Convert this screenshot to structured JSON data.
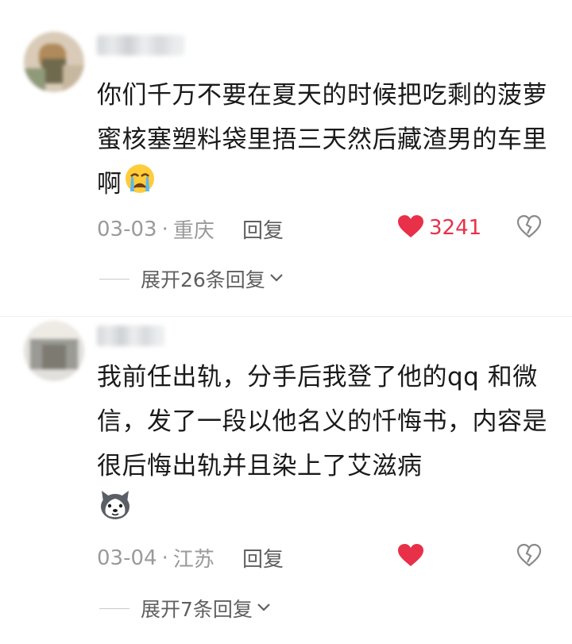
{
  "comments": [
    {
      "text": "你们千万不要在夏天的时候把吃剩的菠萝蜜核塞塑料袋里捂三天然后藏渣男的车里啊",
      "emoji_icon": "crying-face-icon",
      "date": "03-03",
      "location": "重庆",
      "reply_label": "回复",
      "likes": "3241",
      "expand_label": "展开26条回复"
    },
    {
      "text": "我前任出轨，分手后我登了他的qq 和微信，发了一段以他名义的忏悔书，内容是很后悔出轨并且染上了艾滋病",
      "emoji_icon": "husky-dog-icon",
      "date": "03-04",
      "location": "江苏",
      "reply_label": "回复",
      "likes": "",
      "expand_label": "展开7条回复"
    }
  ],
  "colors": {
    "like": "#e83049",
    "meta": "#9a9a9a",
    "text": "#1a1a1a"
  },
  "separator": "·"
}
